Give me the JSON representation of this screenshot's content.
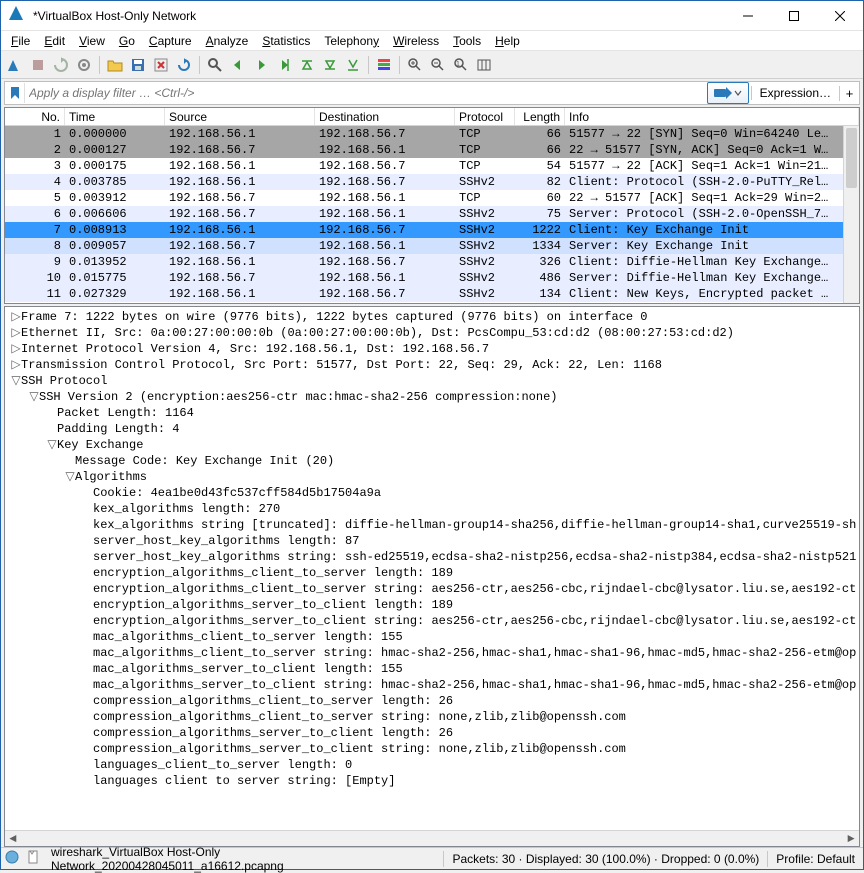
{
  "window": {
    "title": "*VirtualBox Host-Only Network"
  },
  "menu": {
    "file": "File",
    "edit": "Edit",
    "view": "View",
    "go": "Go",
    "capture": "Capture",
    "analyze": "Analyze",
    "statistics": "Statistics",
    "telephony": "Telephony",
    "wireless": "Wireless",
    "tools": "Tools",
    "help": "Help"
  },
  "filter": {
    "placeholder": "Apply a display filter … <Ctrl-/>",
    "expression": "Expression…",
    "plus": "+"
  },
  "columns": {
    "no": "No.",
    "time": "Time",
    "source": "Source",
    "dest": "Destination",
    "proto": "Protocol",
    "len": "Length",
    "info": "Info"
  },
  "packets": [
    {
      "no": "1",
      "time": "0.000000",
      "src": "192.168.56.1",
      "dst": "192.168.56.7",
      "proto": "TCP",
      "len": "66",
      "info": "51577 → 22 [SYN] Seq=0 Win=64240 Le…",
      "style": "gray"
    },
    {
      "no": "2",
      "time": "0.000127",
      "src": "192.168.56.7",
      "dst": "192.168.56.1",
      "proto": "TCP",
      "len": "66",
      "info": "22 → 51577 [SYN, ACK] Seq=0 Ack=1 W…",
      "style": "gray"
    },
    {
      "no": "3",
      "time": "0.000175",
      "src": "192.168.56.1",
      "dst": "192.168.56.7",
      "proto": "TCP",
      "len": "54",
      "info": "51577 → 22 [ACK] Seq=1 Ack=1 Win=21…",
      "style": "white"
    },
    {
      "no": "4",
      "time": "0.003785",
      "src": "192.168.56.1",
      "dst": "192.168.56.7",
      "proto": "SSHv2",
      "len": "82",
      "info": "Client: Protocol (SSH-2.0-PuTTY_Rel…",
      "style": "pale"
    },
    {
      "no": "5",
      "time": "0.003912",
      "src": "192.168.56.7",
      "dst": "192.168.56.1",
      "proto": "TCP",
      "len": "60",
      "info": "22 → 51577 [ACK] Seq=1 Ack=29 Win=2…",
      "style": "white"
    },
    {
      "no": "6",
      "time": "0.006606",
      "src": "192.168.56.7",
      "dst": "192.168.56.1",
      "proto": "SSHv2",
      "len": "75",
      "info": "Server: Protocol (SSH-2.0-OpenSSH_7…",
      "style": "pale"
    },
    {
      "no": "7",
      "time": "0.008913",
      "src": "192.168.56.1",
      "dst": "192.168.56.7",
      "proto": "SSHv2",
      "len": "1222",
      "info": "Client: Key Exchange Init",
      "style": "sel"
    },
    {
      "no": "8",
      "time": "0.009057",
      "src": "192.168.56.7",
      "dst": "192.168.56.1",
      "proto": "SSHv2",
      "len": "1334",
      "info": "Server: Key Exchange Init",
      "style": "mark"
    },
    {
      "no": "9",
      "time": "0.013952",
      "src": "192.168.56.1",
      "dst": "192.168.56.7",
      "proto": "SSHv2",
      "len": "326",
      "info": "Client: Diffie-Hellman Key Exchange…",
      "style": "pale"
    },
    {
      "no": "10",
      "time": "0.015775",
      "src": "192.168.56.7",
      "dst": "192.168.56.1",
      "proto": "SSHv2",
      "len": "486",
      "info": "Server: Diffie-Hellman Key Exchange…",
      "style": "pale"
    },
    {
      "no": "11",
      "time": "0.027329",
      "src": "192.168.56.1",
      "dst": "192.168.56.7",
      "proto": "SSHv2",
      "len": "134",
      "info": "Client: New Keys, Encrypted packet …",
      "style": "pale"
    }
  ],
  "details": [
    {
      "i": 0,
      "caret": ">",
      "t": "Frame 7: 1222 bytes on wire (9776 bits), 1222 bytes captured (9776 bits) on interface 0"
    },
    {
      "i": 0,
      "caret": ">",
      "t": "Ethernet II, Src: 0a:00:27:00:00:0b (0a:00:27:00:00:0b), Dst: PcsCompu_53:cd:d2 (08:00:27:53:cd:d2)"
    },
    {
      "i": 0,
      "caret": ">",
      "t": "Internet Protocol Version 4, Src: 192.168.56.1, Dst: 192.168.56.7"
    },
    {
      "i": 0,
      "caret": ">",
      "t": "Transmission Control Protocol, Src Port: 51577, Dst Port: 22, Seq: 29, Ack: 22, Len: 1168"
    },
    {
      "i": 0,
      "caret": "v",
      "t": "SSH Protocol"
    },
    {
      "i": 1,
      "caret": "v",
      "t": "SSH Version 2 (encryption:aes256-ctr mac:hmac-sha2-256 compression:none)"
    },
    {
      "i": 2,
      "caret": " ",
      "t": "Packet Length: 1164"
    },
    {
      "i": 2,
      "caret": " ",
      "t": "Padding Length: 4"
    },
    {
      "i": 2,
      "caret": "v",
      "t": "Key Exchange"
    },
    {
      "i": 3,
      "caret": " ",
      "t": "Message Code: Key Exchange Init (20)"
    },
    {
      "i": 3,
      "caret": "v",
      "t": "Algorithms"
    },
    {
      "i": 4,
      "caret": " ",
      "t": "Cookie: 4ea1be0d43fc537cff584d5b17504a9a"
    },
    {
      "i": 4,
      "caret": " ",
      "t": "kex_algorithms length: 270"
    },
    {
      "i": 4,
      "caret": " ",
      "t": "kex_algorithms string [truncated]: diffie-hellman-group14-sha256,diffie-hellman-group14-sha1,curve25519-sh"
    },
    {
      "i": 4,
      "caret": " ",
      "t": "server_host_key_algorithms length: 87"
    },
    {
      "i": 4,
      "caret": " ",
      "t": "server_host_key_algorithms string: ssh-ed25519,ecdsa-sha2-nistp256,ecdsa-sha2-nistp384,ecdsa-sha2-nistp521"
    },
    {
      "i": 4,
      "caret": " ",
      "t": "encryption_algorithms_client_to_server length: 189"
    },
    {
      "i": 4,
      "caret": " ",
      "t": "encryption_algorithms_client_to_server string: aes256-ctr,aes256-cbc,rijndael-cbc@lysator.liu.se,aes192-ct"
    },
    {
      "i": 4,
      "caret": " ",
      "t": "encryption_algorithms_server_to_client length: 189"
    },
    {
      "i": 4,
      "caret": " ",
      "t": "encryption_algorithms_server_to_client string: aes256-ctr,aes256-cbc,rijndael-cbc@lysator.liu.se,aes192-ct"
    },
    {
      "i": 4,
      "caret": " ",
      "t": "mac_algorithms_client_to_server length: 155"
    },
    {
      "i": 4,
      "caret": " ",
      "t": "mac_algorithms_client_to_server string: hmac-sha2-256,hmac-sha1,hmac-sha1-96,hmac-md5,hmac-sha2-256-etm@op"
    },
    {
      "i": 4,
      "caret": " ",
      "t": "mac_algorithms_server_to_client length: 155"
    },
    {
      "i": 4,
      "caret": " ",
      "t": "mac_algorithms_server_to_client string: hmac-sha2-256,hmac-sha1,hmac-sha1-96,hmac-md5,hmac-sha2-256-etm@op"
    },
    {
      "i": 4,
      "caret": " ",
      "t": "compression_algorithms_client_to_server length: 26"
    },
    {
      "i": 4,
      "caret": " ",
      "t": "compression_algorithms_client_to_server string: none,zlib,zlib@openssh.com"
    },
    {
      "i": 4,
      "caret": " ",
      "t": "compression_algorithms_server_to_client length: 26"
    },
    {
      "i": 4,
      "caret": " ",
      "t": "compression_algorithms_server_to_client string: none,zlib,zlib@openssh.com"
    },
    {
      "i": 4,
      "caret": " ",
      "t": "languages_client_to_server length: 0"
    },
    {
      "i": 4,
      "caret": " ",
      "t": "languages client to server string: [Empty]"
    }
  ],
  "status": {
    "file": "wireshark_VirtualBox Host-Only Network_20200428045011_a16612.pcapng",
    "packets": "Packets: 30 · Displayed: 30 (100.0%) · Dropped: 0 (0.0%)",
    "profile": "Profile: Default"
  }
}
